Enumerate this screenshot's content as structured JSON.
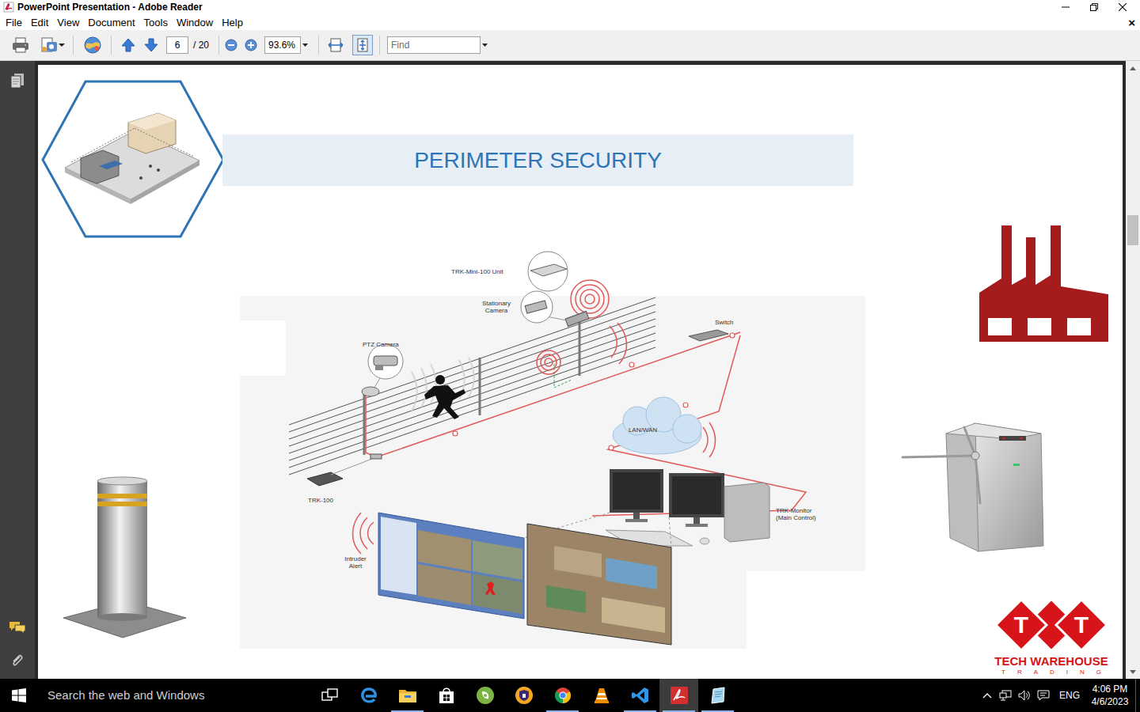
{
  "window": {
    "title": "PowerPoint Presentation - Adobe Reader"
  },
  "menu": {
    "items": [
      "File",
      "Edit",
      "View",
      "Document",
      "Tools",
      "Window",
      "Help"
    ],
    "close": "×"
  },
  "toolbar": {
    "page": "6",
    "page_total": "/ 20",
    "zoom": "93.6%",
    "find_placeholder": "Find",
    "fit_width_selected": false,
    "fit_page_selected": true
  },
  "scrollbar": {
    "position": 0.25
  },
  "slide": {
    "title": "PERIMETER SECURITY",
    "diagram": {
      "labels": [
        "TRK-Mini-100 Unit",
        "Stationary Camera",
        "PTZ Camera",
        "Switch",
        "LAN/WAN",
        "TRK-100",
        "TRK-Monitor (Main Control)",
        "Intruder Alert"
      ]
    },
    "logo": {
      "letters": [
        "T",
        "T"
      ],
      "name": "TECH WAREHOUSE",
      "tagline": "TRADING"
    }
  },
  "taskbar": {
    "search": "Search the web and Windows",
    "apps": [
      {
        "running": false,
        "selected": false
      },
      {
        "running": false,
        "selected": false
      },
      {
        "running": true,
        "selected": false
      },
      {
        "running": false,
        "selected": false
      },
      {
        "running": false,
        "selected": false
      },
      {
        "running": false,
        "selected": false
      },
      {
        "running": true,
        "selected": false
      },
      {
        "running": false,
        "selected": false
      },
      {
        "running": true,
        "selected": false
      },
      {
        "running": true,
        "selected": true
      },
      {
        "running": true,
        "selected": false
      }
    ],
    "tray": {
      "language": "ENG",
      "time": "4:06 PM",
      "date": "4/6/2023"
    }
  }
}
